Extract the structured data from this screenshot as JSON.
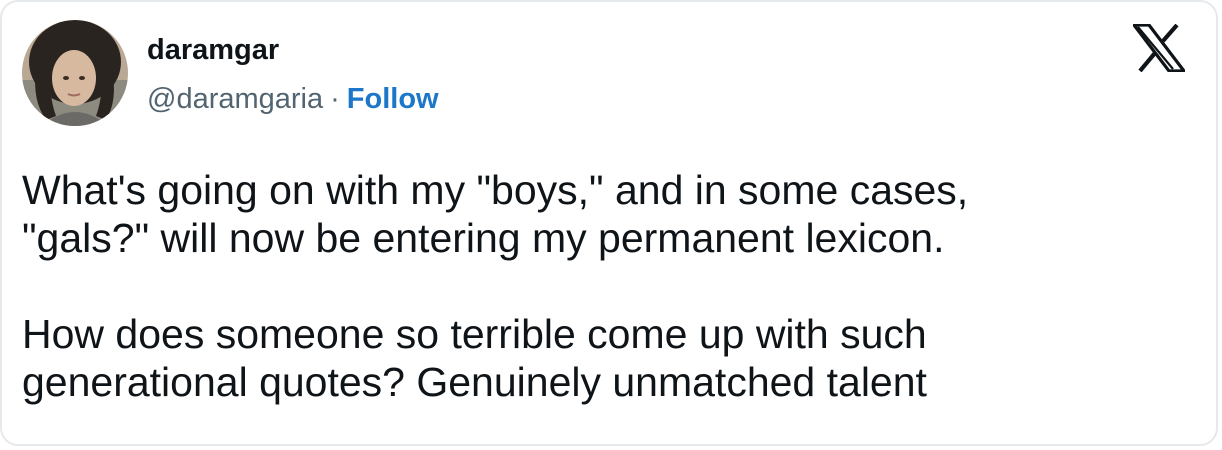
{
  "author": {
    "display_name": "daramgar",
    "handle": "@daramgaria",
    "separator": "·",
    "follow_label": "Follow"
  },
  "logo": {
    "icon": "x-logo-icon"
  },
  "tweet": {
    "paragraphs": [
      "What's going on with my \"boys,\" and in some cases,\n\"gals?\" will now be entering my permanent lexicon.",
      "How does someone so terrible come up with such\ngenerational quotes? Genuinely unmatched talent"
    ]
  },
  "colors": {
    "text": "#0f1419",
    "secondary_text": "#536471",
    "follow_link": "#1d77c9",
    "border": "#e6e9ec"
  }
}
